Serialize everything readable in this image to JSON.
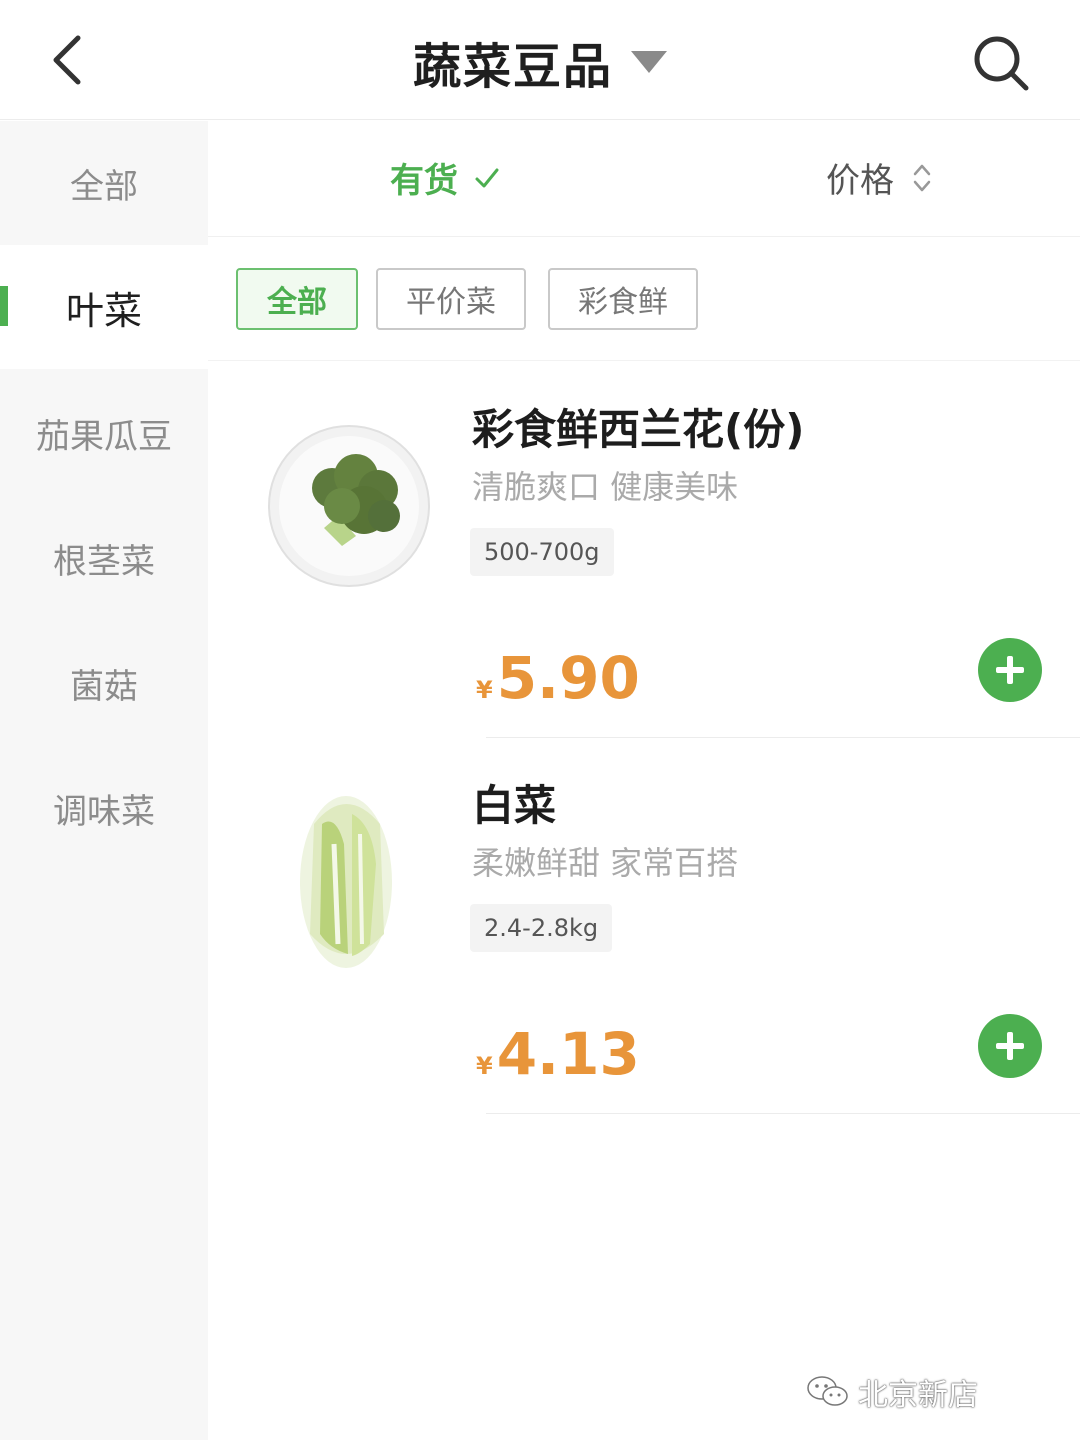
{
  "header": {
    "title": "蔬菜豆品",
    "back_icon": "chevron-left-icon",
    "dropdown_icon": "caret-down-icon",
    "search_icon": "search-icon"
  },
  "sidebar": {
    "items": [
      {
        "label": "全部",
        "active": false
      },
      {
        "label": "叶菜",
        "active": true
      },
      {
        "label": "茄果瓜豆",
        "active": false
      },
      {
        "label": "根茎菜",
        "active": false
      },
      {
        "label": "菌菇",
        "active": false
      },
      {
        "label": "调味菜",
        "active": false
      }
    ],
    "accent_color": "#4caf50"
  },
  "filters": {
    "in_stock_label": "有货",
    "in_stock_checked": true,
    "price_label": "价格"
  },
  "chips": [
    {
      "label": "全部",
      "active": true
    },
    {
      "label": "平价菜",
      "active": false
    },
    {
      "label": "彩食鲜",
      "active": false
    }
  ],
  "products": [
    {
      "name": "彩食鲜西兰花(份)",
      "desc": "清脆爽口 健康美味",
      "spec": "500-700g",
      "currency": "¥",
      "price": "5.90",
      "image": "broccoli-image"
    },
    {
      "name": "白菜",
      "desc": "柔嫩鲜甜 家常百搭",
      "spec": "2.4-2.8kg",
      "currency": "¥",
      "price": "4.13",
      "image": "napa-cabbage-image"
    }
  ],
  "watermark": {
    "text": "北京新店",
    "icon": "wechat-icon"
  },
  "colors": {
    "accent": "#4caf50",
    "price": "#e8953a"
  }
}
